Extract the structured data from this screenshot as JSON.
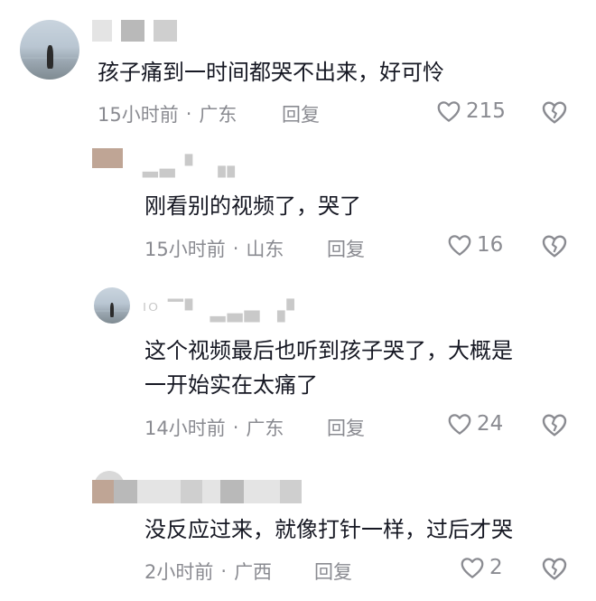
{
  "comments": [
    {
      "text": "孩子痛到一时间都哭不出来，好可怜",
      "time": "15小时前",
      "sep": "·",
      "location": "广东",
      "reply_label": "回复",
      "likes": "215"
    },
    {
      "text": "刚看别的视频了，哭了",
      "time": "15小时前",
      "sep": "·",
      "location": "山东",
      "reply_label": "回复",
      "likes": "16"
    },
    {
      "text": "这个视频最后也听到孩子哭了，大概是\n一开始实在太痛了",
      "time": "14小时前",
      "sep": "·",
      "location": "广东",
      "reply_label": "回复",
      "likes": "24"
    },
    {
      "text": "没反应过来，就像打针一样，过后才哭",
      "time": "2小时前",
      "sep": "·",
      "location": "广西",
      "reply_label": "回复",
      "likes": "2"
    }
  ],
  "colors": {
    "text": "#161823",
    "meta": "#8a8b91",
    "icon": "#8a8b91"
  },
  "icons": {
    "like": "heart-outline-icon",
    "dislike": "broken-heart-icon"
  }
}
